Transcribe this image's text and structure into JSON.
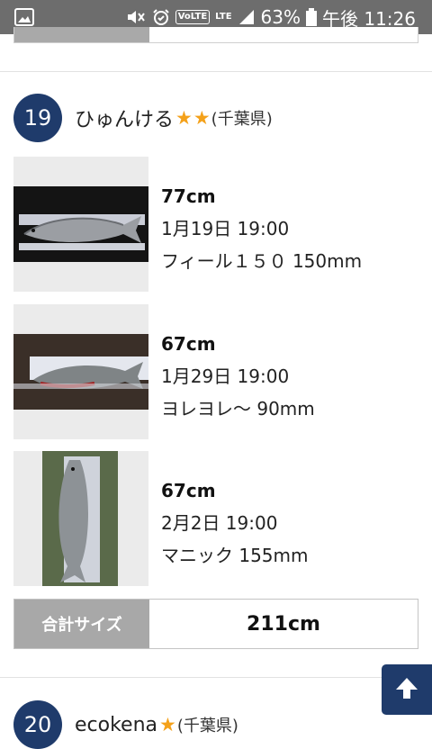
{
  "status_bar": {
    "battery": "63%",
    "time": "午後 11:26",
    "volte_label": "VoLTE",
    "lte_label": "LTE"
  },
  "ranking": {
    "current": {
      "rank": "19",
      "name": "ひゅんける",
      "stars": "★★",
      "prefecture": "(千葉県)",
      "catches": [
        {
          "size": "77cm",
          "datetime": "1月19日 19:00",
          "lure": "フィール１５０ 150mm"
        },
        {
          "size": "67cm",
          "datetime": "1月29日 19:00",
          "lure": "ヨレヨレ～ 90mm"
        },
        {
          "size": "67cm",
          "datetime": "2月2日 19:00",
          "lure": "マニック 155mm"
        }
      ],
      "total_label": "合計サイズ",
      "total_value": "211cm"
    },
    "next": {
      "rank": "20",
      "name": "ecokena",
      "stars": "★",
      "prefecture": "(千葉県)"
    }
  },
  "colors": {
    "rank_badge": "#1f3b6b",
    "star": "#f4a11a",
    "status_bar": "#6d6d6d"
  },
  "icons": [
    "gallery-icon",
    "mute-icon",
    "alarm-icon",
    "signal-icon",
    "battery-icon",
    "arrow-up-icon"
  ]
}
